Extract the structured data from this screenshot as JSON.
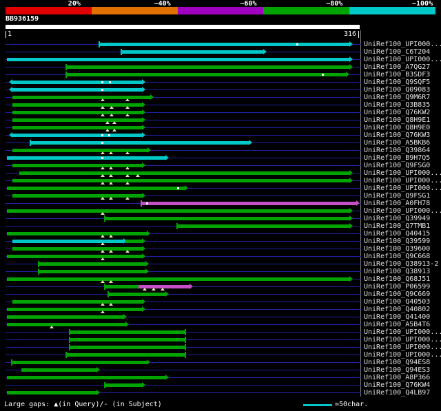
{
  "color_key": {
    "labels": [
      "20%",
      "~40%",
      "~60%",
      "~80%",
      "~100%"
    ],
    "colors": [
      "#e00000",
      "#e07000",
      "#a000c0",
      "#00a400",
      "#00c8c8"
    ]
  },
  "query": {
    "name": "BB936159",
    "start": "1",
    "end": "316"
  },
  "footer": {
    "gaps_legend": "Large gaps: ▲(in Query)/- (in Subject)",
    "scale_text": "=50char."
  },
  "chart_data": {
    "type": "alignment-overview",
    "xlim": [
      1,
      316
    ],
    "bar_colors": {
      "cyan": "#00c8c8",
      "green": "#00a400",
      "magenta": "#c44fc4"
    },
    "_key": {
      "s": "segment start (query coords)",
      "e": "segment end",
      "c": "color",
      "al": "left arrowhead",
      "ar": "right arrowhead",
      "tl": "left end tick",
      "tr": "right end tick",
      "gq": "large gap in query (triangle)",
      "gs": "gap in subject (dash)"
    },
    "rows": [
      {
        "label": "UniRef100_UPI000...",
        "segments": [
          {
            "s": 85,
            "e": 308,
            "c": "cyan",
            "ar": true,
            "tl": true
          }
        ],
        "gs": [
          261
        ]
      },
      {
        "label": "UniRef100_C6T204",
        "segments": [
          {
            "s": 105,
            "e": 231,
            "c": "cyan",
            "ar": true,
            "tl": true
          }
        ]
      },
      {
        "label": "UniRef100_UPI000...",
        "segments": [
          {
            "s": 2,
            "e": 308,
            "c": "cyan",
            "ar": true
          }
        ]
      },
      {
        "label": "UniRef100_A7QG27",
        "segments": [
          {
            "s": 56,
            "e": 308,
            "c": "green",
            "ar": true,
            "tl": true
          }
        ]
      },
      {
        "label": "UniRef100_B3SDF3",
        "segments": [
          {
            "s": 56,
            "e": 305,
            "c": "green",
            "ar": true,
            "tl": true
          }
        ],
        "gs": [
          284
        ]
      },
      {
        "label": "UniRef100_Q9SQF5",
        "segments": [
          {
            "s": 7,
            "e": 123,
            "c": "cyan",
            "al": true,
            "ar": true
          }
        ],
        "gs": [
          87,
          94
        ]
      },
      {
        "label": "UniRef100_Q09083",
        "segments": [
          {
            "s": 7,
            "e": 123,
            "c": "cyan",
            "al": true,
            "ar": true
          }
        ],
        "gs": [
          87
        ]
      },
      {
        "label": "UniRef100_Q9M6R7",
        "segments": [
          {
            "s": 7,
            "e": 130,
            "c": "green",
            "ar": true
          }
        ],
        "gq": [
          88,
          110
        ]
      },
      {
        "label": "UniRef100_Q3B835",
        "segments": [
          {
            "s": 7,
            "e": 123,
            "c": "green",
            "ar": true
          }
        ],
        "gq": [
          88,
          96,
          110
        ]
      },
      {
        "label": "UniRef100_Q76KW2",
        "segments": [
          {
            "s": 7,
            "e": 123,
            "c": "green",
            "ar": true
          }
        ],
        "gq": [
          88,
          96,
          110
        ]
      },
      {
        "label": "UniRef100_Q8H9E1",
        "segments": [
          {
            "s": 7,
            "e": 123,
            "c": "green",
            "ar": true
          }
        ],
        "gq": [
          92,
          98
        ]
      },
      {
        "label": "UniRef100_Q8H9E0",
        "segments": [
          {
            "s": 7,
            "e": 123,
            "c": "green",
            "ar": true
          }
        ],
        "gq": [
          92,
          98
        ]
      },
      {
        "label": "UniRef100_Q76KW3",
        "segments": [
          {
            "s": 7,
            "e": 123,
            "c": "cyan",
            "al": true,
            "ar": true
          }
        ],
        "gs": [
          87,
          93
        ]
      },
      {
        "label": "UniRef100_A5BKB6",
        "segments": [
          {
            "s": 24,
            "e": 218,
            "c": "cyan",
            "ar": true,
            "tl": true
          }
        ],
        "gs": [
          87
        ]
      },
      {
        "label": "UniRef100_Q39864",
        "segments": [
          {
            "s": 7,
            "e": 128,
            "c": "green",
            "ar": true
          }
        ],
        "gq": [
          88,
          95,
          110
        ]
      },
      {
        "label": "UniRef100_B9H7Q5",
        "segments": [
          {
            "s": 2,
            "e": 144,
            "c": "cyan",
            "ar": true
          }
        ],
        "gs": [
          87
        ]
      },
      {
        "label": "UniRef100_Q9FSG0",
        "segments": [
          {
            "s": 7,
            "e": 123,
            "c": "green",
            "ar": true
          }
        ],
        "gq": [
          88,
          95,
          110
        ]
      },
      {
        "label": "UniRef100_UPI000...",
        "segments": [
          {
            "s": 13,
            "e": 308,
            "c": "green",
            "ar": true
          }
        ],
        "gq": [
          88,
          95,
          110,
          119
        ]
      },
      {
        "label": "UniRef100_UPI000...",
        "segments": [
          {
            "s": 7,
            "e": 308,
            "c": "green",
            "ar": true
          }
        ],
        "gq": [
          88,
          95,
          110
        ]
      },
      {
        "label": "UniRef100_UPI000...",
        "segments": [
          {
            "s": 2,
            "e": 161,
            "c": "green",
            "ar": true
          }
        ],
        "gs": [
          155
        ]
      },
      {
        "label": "UniRef100_Q9FSG1",
        "segments": [
          {
            "s": 7,
            "e": 123,
            "c": "green",
            "ar": true
          }
        ],
        "gq": [
          88,
          95,
          110
        ]
      },
      {
        "label": "UniRef100_A0FH78",
        "segments": [
          {
            "s": 123,
            "e": 314,
            "c": "magenta",
            "ar": true,
            "tl": true
          }
        ],
        "gs": [
          127
        ]
      },
      {
        "label": "UniRef100_UPI000...",
        "segments": [
          {
            "s": 2,
            "e": 308,
            "c": "green",
            "ar": true
          }
        ],
        "gq": [
          88
        ]
      },
      {
        "label": "UniRef100_Q39949",
        "segments": [
          {
            "s": 90,
            "e": 308,
            "c": "green",
            "ar": true,
            "tl": true
          }
        ]
      },
      {
        "label": "UniRef100_Q7TMB1",
        "segments": [
          {
            "s": 155,
            "e": 308,
            "c": "green",
            "ar": true,
            "tl": true
          }
        ]
      },
      {
        "label": "UniRef100_Q40415",
        "segments": [
          {
            "s": 2,
            "e": 127,
            "c": "green",
            "ar": true
          }
        ],
        "gq": [
          88,
          95
        ]
      },
      {
        "label": "UniRef100_Q39599",
        "segments": [
          {
            "s": 7,
            "e": 106,
            "c": "cyan",
            "ar": true
          },
          {
            "s": 108,
            "e": 123,
            "c": "green",
            "ar": true
          }
        ],
        "gq": [
          88
        ]
      },
      {
        "label": "UniRef100_Q39600",
        "segments": [
          {
            "s": 7,
            "e": 123,
            "c": "green",
            "ar": true
          }
        ],
        "gq": [
          88,
          95,
          110
        ]
      },
      {
        "label": "UniRef100_Q9C668",
        "segments": [
          {
            "s": 2,
            "e": 123,
            "c": "green",
            "ar": true
          }
        ],
        "gq": [
          88
        ]
      },
      {
        "label": "UniRef100_Q38913-2",
        "segments": [
          {
            "s": 31,
            "e": 126,
            "c": "green",
            "ar": true,
            "tl": true
          }
        ]
      },
      {
        "label": "UniRef100_Q38913",
        "segments": [
          {
            "s": 31,
            "e": 126,
            "c": "green",
            "ar": true,
            "tl": true
          }
        ]
      },
      {
        "label": "UniRef100_Q68J51",
        "segments": [
          {
            "s": 2,
            "e": 308,
            "c": "green",
            "ar": true
          }
        ],
        "gq": [
          88,
          95
        ]
      },
      {
        "label": "UniRef100_P06599",
        "segments": [
          {
            "s": 90,
            "e": 120,
            "c": "green",
            "tl": true
          },
          {
            "s": 120,
            "e": 165,
            "c": "magenta",
            "ar": true
          }
        ],
        "gq": [
          125,
          133,
          141
        ]
      },
      {
        "label": "UniRef100_Q9C669",
        "segments": [
          {
            "s": 93,
            "e": 144,
            "c": "green",
            "ar": true,
            "tl": true
          }
        ]
      },
      {
        "label": "UniRef100_Q40503",
        "segments": [
          {
            "s": 7,
            "e": 123,
            "c": "green",
            "ar": true
          }
        ],
        "gq": [
          88,
          95
        ]
      },
      {
        "label": "UniRef100_Q40802",
        "segments": [
          {
            "s": 2,
            "e": 123,
            "c": "green",
            "ar": true
          }
        ],
        "gq": [
          88
        ]
      },
      {
        "label": "UniRef100_Q41400",
        "segments": [
          {
            "s": 2,
            "e": 106,
            "c": "green",
            "ar": true
          }
        ]
      },
      {
        "label": "UniRef100_A5B4T6",
        "segments": [
          {
            "s": 2,
            "e": 108,
            "c": "green",
            "ar": true
          }
        ],
        "gq": [
          42
        ]
      },
      {
        "label": "UniRef100_UPI000...",
        "segments": [
          {
            "s": 59,
            "e": 161,
            "c": "green",
            "tl": true,
            "tr": true
          }
        ]
      },
      {
        "label": "UniRef100_UPI000...",
        "segments": [
          {
            "s": 59,
            "e": 161,
            "c": "green",
            "tl": true,
            "tr": true
          }
        ]
      },
      {
        "label": "UniRef100_UPI000...",
        "segments": [
          {
            "s": 59,
            "e": 161,
            "c": "green",
            "tl": true,
            "tr": true
          }
        ]
      },
      {
        "label": "UniRef100_UPI000...",
        "segments": [
          {
            "s": 56,
            "e": 161,
            "c": "green",
            "tl": true,
            "tr": true
          }
        ]
      },
      {
        "label": "UniRef100_Q94ES8",
        "segments": [
          {
            "s": 7,
            "e": 127,
            "c": "green",
            "ar": true,
            "tl": true
          }
        ]
      },
      {
        "label": "UniRef100_Q94ES3",
        "segments": [
          {
            "s": 15,
            "e": 82,
            "c": "green",
            "ar": true
          }
        ]
      },
      {
        "label": "UniRef100_A8P366",
        "segments": [
          {
            "s": 2,
            "e": 144,
            "c": "green",
            "ar": true
          }
        ]
      },
      {
        "label": "UniRef100_Q76KW4",
        "segments": [
          {
            "s": 90,
            "e": 123,
            "c": "green",
            "ar": true,
            "tl": true
          }
        ]
      },
      {
        "label": "UniRef100_Q4LB97",
        "segments": [
          {
            "s": 2,
            "e": 82,
            "c": "green",
            "ar": true
          }
        ]
      }
    ]
  }
}
